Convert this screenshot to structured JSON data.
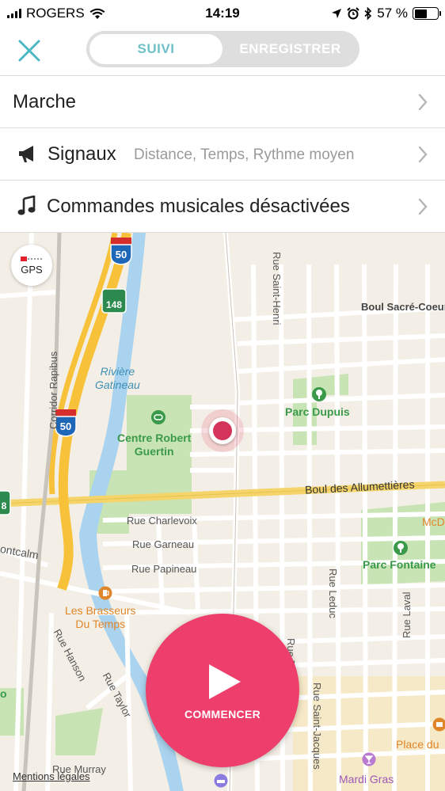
{
  "status_bar": {
    "carrier": "ROGERS",
    "time": "14:19",
    "battery": "57 %",
    "battery_level": 0.57
  },
  "header": {
    "close_icon": "close-icon",
    "tabs": [
      {
        "label": "SUIVI",
        "active": true
      },
      {
        "label": "ENREGISTRER",
        "active": false
      }
    ],
    "accent_color": "#6fc0c8"
  },
  "settings": {
    "activity": {
      "label": "Marche"
    },
    "signals": {
      "label": "Signaux",
      "value": "Distance, Temps, Rythme moyen",
      "icon": "megaphone-icon"
    },
    "music": {
      "label": "Commandes musicales désactivées",
      "icon": "music-note-icon"
    }
  },
  "map": {
    "gps_label": "GPS",
    "labels": {
      "rue_saint_henri": "Rue Saint-Henri",
      "boul_sacre_coeur": "Boul Sacré-Coeur",
      "corridor_rapibus": "Corridor Rapibus",
      "riviere_gatineau": "Rivière\nGatineau",
      "parc_dupuis": "Parc Dupuis",
      "centre_robert_guertin": "Centre Robert\nGuertin",
      "boul_allumettieres": "Boul des Allumettières",
      "rue_charlevoix": "Rue Charlevoix",
      "rue_garneau": "Rue Garneau",
      "rue_papineau": "Rue Papineau",
      "montcalm": "ontcalm",
      "parc_fontaine": "Parc Fontaine",
      "mcd": "McD",
      "rue_leduc": "Rue Leduc",
      "rue_laval": "Rue Laval",
      "les_brasseurs": "Les Brasseurs\nDu Temps",
      "rue_hanson": "Rue Hanson",
      "rue_taylor": "Rue Taylor",
      "rue_eddy": "Rue Edd",
      "rue_saint_jacques": "Rue Saint-Jacques",
      "rue_murray": "Rue Murray",
      "place_du": "Place du",
      "mardi_gras": "Mardi Gras",
      "edge_o": "o"
    },
    "shields": {
      "hwy_50": "50",
      "hwy_148": "148",
      "hwy_8": "8"
    },
    "legal_link": "Mentions légales"
  },
  "start_button": {
    "label": "COMMENCER",
    "color": "#ee3f6c"
  }
}
